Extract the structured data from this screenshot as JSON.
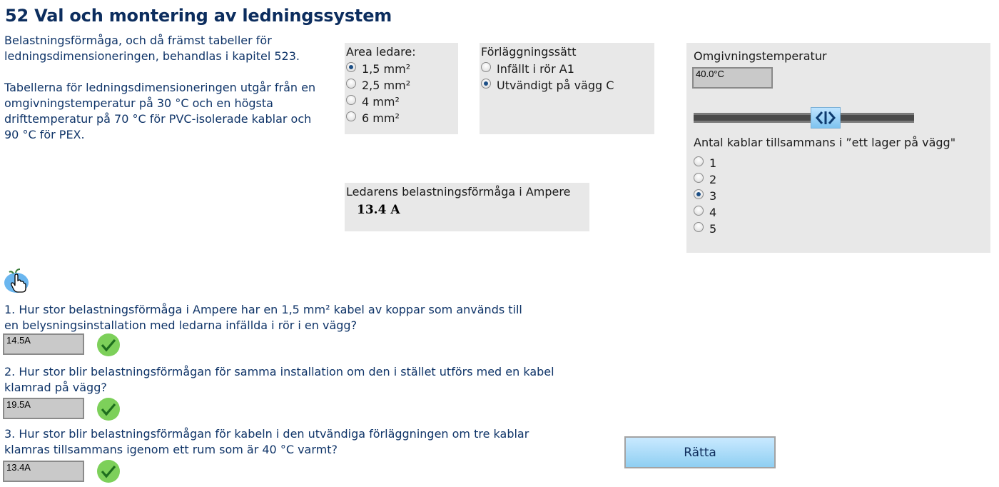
{
  "title": "52 Val och montering av ledningssystem",
  "intro": {
    "paragraph1": "Belastningsförmåga, och då främst tabeller för ledningsdimensioneringen, behandlas i kapitel 523.",
    "paragraph2": "Tabellerna för ledningsdimensioneringen utgår från en omgivningstemperatur på 30 °C och en högsta drifttemperatur på 70 °C för PVC-isolerade kablar och 90 °C för PEX."
  },
  "area": {
    "label": "Area ledare:",
    "options": [
      "1,5 mm²",
      "2,5 mm²",
      "4 mm²",
      "6 mm²"
    ],
    "selected": "1,5 mm²"
  },
  "installation": {
    "label": "Förläggningssätt",
    "options": [
      "Infällt i rör A1",
      "Utvändigt på vägg C"
    ],
    "selected": "Utvändigt på vägg C"
  },
  "result": {
    "label": "Ledarens belastningsförmåga i Ampere",
    "value": "13.4 A"
  },
  "temperature": {
    "label": "Omgivningstemperatur",
    "value": "40.0°C"
  },
  "cable_count": {
    "label": "Antal kablar tillsammans i ”ett lager på vägg\"",
    "options": [
      "1",
      "2",
      "3",
      "4",
      "5"
    ],
    "selected": "3"
  },
  "questions": [
    {
      "text": "1. Hur stor belastningsförmåga i Ampere har en 1,5 mm² kabel av koppar som används till en belysningsinstallation med ledarna infällda i rör i en vägg?",
      "answer": "14.5A"
    },
    {
      "text": "2. Hur stor blir belastningsförmågan för samma installation om den i stället utförs med en kabel klamrad på vägg?",
      "answer": "19.5A"
    },
    {
      "text": "3. Hur stor blir belastningsförmågan för kabeln i den utvändiga förläggningen om tre kablar klamras tillsammans igenom ett rum som är 40 °C varmt?",
      "answer": "13.4A"
    }
  ],
  "submit_label": "Rätta",
  "colors": {
    "heading": "#0c2d5e",
    "panel": "#e8e8e8",
    "check": "#7dd05a",
    "button": "#8fcff2"
  }
}
